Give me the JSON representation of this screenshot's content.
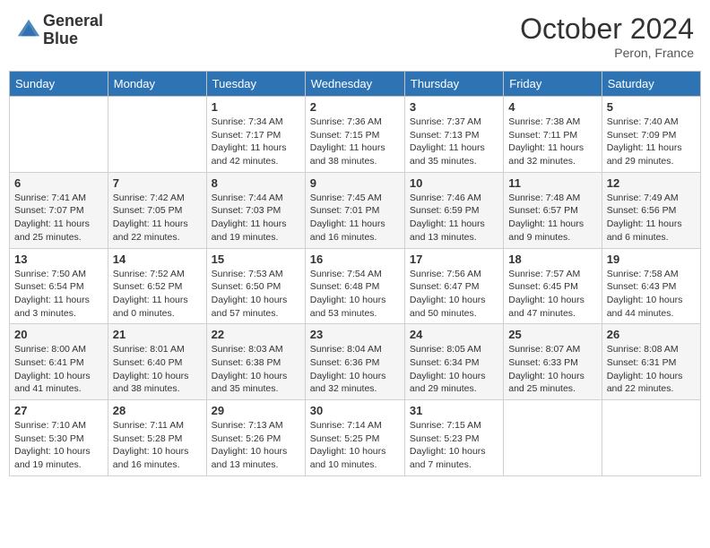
{
  "header": {
    "logo_line1": "General",
    "logo_line2": "Blue",
    "month_title": "October 2024",
    "location": "Peron, France"
  },
  "columns": [
    "Sunday",
    "Monday",
    "Tuesday",
    "Wednesday",
    "Thursday",
    "Friday",
    "Saturday"
  ],
  "weeks": [
    [
      {
        "day": "",
        "info": ""
      },
      {
        "day": "",
        "info": ""
      },
      {
        "day": "1",
        "info": "Sunrise: 7:34 AM\nSunset: 7:17 PM\nDaylight: 11 hours and 42 minutes."
      },
      {
        "day": "2",
        "info": "Sunrise: 7:36 AM\nSunset: 7:15 PM\nDaylight: 11 hours and 38 minutes."
      },
      {
        "day": "3",
        "info": "Sunrise: 7:37 AM\nSunset: 7:13 PM\nDaylight: 11 hours and 35 minutes."
      },
      {
        "day": "4",
        "info": "Sunrise: 7:38 AM\nSunset: 7:11 PM\nDaylight: 11 hours and 32 minutes."
      },
      {
        "day": "5",
        "info": "Sunrise: 7:40 AM\nSunset: 7:09 PM\nDaylight: 11 hours and 29 minutes."
      }
    ],
    [
      {
        "day": "6",
        "info": "Sunrise: 7:41 AM\nSunset: 7:07 PM\nDaylight: 11 hours and 25 minutes."
      },
      {
        "day": "7",
        "info": "Sunrise: 7:42 AM\nSunset: 7:05 PM\nDaylight: 11 hours and 22 minutes."
      },
      {
        "day": "8",
        "info": "Sunrise: 7:44 AM\nSunset: 7:03 PM\nDaylight: 11 hours and 19 minutes."
      },
      {
        "day": "9",
        "info": "Sunrise: 7:45 AM\nSunset: 7:01 PM\nDaylight: 11 hours and 16 minutes."
      },
      {
        "day": "10",
        "info": "Sunrise: 7:46 AM\nSunset: 6:59 PM\nDaylight: 11 hours and 13 minutes."
      },
      {
        "day": "11",
        "info": "Sunrise: 7:48 AM\nSunset: 6:57 PM\nDaylight: 11 hours and 9 minutes."
      },
      {
        "day": "12",
        "info": "Sunrise: 7:49 AM\nSunset: 6:56 PM\nDaylight: 11 hours and 6 minutes."
      }
    ],
    [
      {
        "day": "13",
        "info": "Sunrise: 7:50 AM\nSunset: 6:54 PM\nDaylight: 11 hours and 3 minutes."
      },
      {
        "day": "14",
        "info": "Sunrise: 7:52 AM\nSunset: 6:52 PM\nDaylight: 11 hours and 0 minutes."
      },
      {
        "day": "15",
        "info": "Sunrise: 7:53 AM\nSunset: 6:50 PM\nDaylight: 10 hours and 57 minutes."
      },
      {
        "day": "16",
        "info": "Sunrise: 7:54 AM\nSunset: 6:48 PM\nDaylight: 10 hours and 53 minutes."
      },
      {
        "day": "17",
        "info": "Sunrise: 7:56 AM\nSunset: 6:47 PM\nDaylight: 10 hours and 50 minutes."
      },
      {
        "day": "18",
        "info": "Sunrise: 7:57 AM\nSunset: 6:45 PM\nDaylight: 10 hours and 47 minutes."
      },
      {
        "day": "19",
        "info": "Sunrise: 7:58 AM\nSunset: 6:43 PM\nDaylight: 10 hours and 44 minutes."
      }
    ],
    [
      {
        "day": "20",
        "info": "Sunrise: 8:00 AM\nSunset: 6:41 PM\nDaylight: 10 hours and 41 minutes."
      },
      {
        "day": "21",
        "info": "Sunrise: 8:01 AM\nSunset: 6:40 PM\nDaylight: 10 hours and 38 minutes."
      },
      {
        "day": "22",
        "info": "Sunrise: 8:03 AM\nSunset: 6:38 PM\nDaylight: 10 hours and 35 minutes."
      },
      {
        "day": "23",
        "info": "Sunrise: 8:04 AM\nSunset: 6:36 PM\nDaylight: 10 hours and 32 minutes."
      },
      {
        "day": "24",
        "info": "Sunrise: 8:05 AM\nSunset: 6:34 PM\nDaylight: 10 hours and 29 minutes."
      },
      {
        "day": "25",
        "info": "Sunrise: 8:07 AM\nSunset: 6:33 PM\nDaylight: 10 hours and 25 minutes."
      },
      {
        "day": "26",
        "info": "Sunrise: 8:08 AM\nSunset: 6:31 PM\nDaylight: 10 hours and 22 minutes."
      }
    ],
    [
      {
        "day": "27",
        "info": "Sunrise: 7:10 AM\nSunset: 5:30 PM\nDaylight: 10 hours and 19 minutes."
      },
      {
        "day": "28",
        "info": "Sunrise: 7:11 AM\nSunset: 5:28 PM\nDaylight: 10 hours and 16 minutes."
      },
      {
        "day": "29",
        "info": "Sunrise: 7:13 AM\nSunset: 5:26 PM\nDaylight: 10 hours and 13 minutes."
      },
      {
        "day": "30",
        "info": "Sunrise: 7:14 AM\nSunset: 5:25 PM\nDaylight: 10 hours and 10 minutes."
      },
      {
        "day": "31",
        "info": "Sunrise: 7:15 AM\nSunset: 5:23 PM\nDaylight: 10 hours and 7 minutes."
      },
      {
        "day": "",
        "info": ""
      },
      {
        "day": "",
        "info": ""
      }
    ]
  ]
}
